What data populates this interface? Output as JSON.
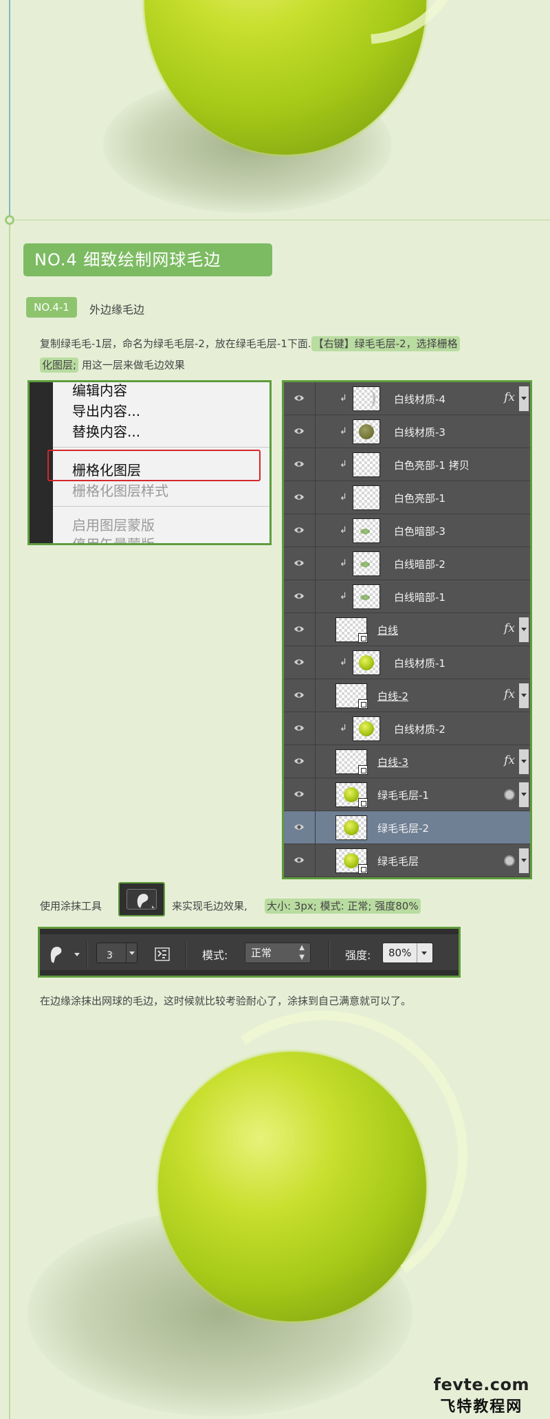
{
  "section": {
    "title": "NO.4  细致绘制网球毛边"
  },
  "subsection": {
    "badge": "NO.4-1",
    "title": "外边缘毛边"
  },
  "instruction1": {
    "line1_plain": "复制绿毛毛-1层，命名为绿毛毛层-2，放在绿毛毛层-1下面.",
    "line1_highlight": "【右键】绿毛毛层-2，选择栅格",
    "line2_highlight": "化图层;",
    "line2_plain": " 用这一层来做毛边效果"
  },
  "context_menu": {
    "items": [
      "编辑内容",
      "导出内容...",
      "替换内容...",
      "栅格化图层",
      "栅格化图层样式",
      "启用图层蒙版",
      "停用矢量蒙版"
    ],
    "selected": "栅格化图层"
  },
  "layers": [
    {
      "name": "白线材质-4",
      "kind": "clipped",
      "thumb": "seam",
      "fx": "fx"
    },
    {
      "name": "白线材质-3",
      "kind": "clipped",
      "thumb": "ball-dark"
    },
    {
      "name": "白色亮部-1 拷贝",
      "kind": "clipped",
      "thumb": "empty"
    },
    {
      "name": "白色亮部-1",
      "kind": "clipped",
      "thumb": "empty"
    },
    {
      "name": "白色暗部-3",
      "kind": "clipped",
      "thumb": "dot"
    },
    {
      "name": "白线暗部-2",
      "kind": "clipped",
      "thumb": "dot"
    },
    {
      "name": "白线暗部-1",
      "kind": "clipped",
      "thumb": "dot"
    },
    {
      "name": "白线",
      "kind": "smart",
      "thumb": "smart",
      "fx": "fx"
    },
    {
      "name": "白线材质-1",
      "kind": "clipped",
      "thumb": "ball"
    },
    {
      "name": "白线-2",
      "kind": "smart",
      "thumb": "smart",
      "fx": "fx"
    },
    {
      "name": "白线材质-2",
      "kind": "clipped",
      "thumb": "ball"
    },
    {
      "name": "白线-3",
      "kind": "smart",
      "thumb": "smart",
      "fx": "fx"
    },
    {
      "name": "绿毛毛层-1",
      "kind": "base",
      "thumb": "ball-smart",
      "filter": true
    },
    {
      "name": "绿毛毛层-2",
      "kind": "base",
      "thumb": "ball",
      "selected": true
    },
    {
      "name": "绿毛毛层",
      "kind": "base",
      "thumb": "ball-smart",
      "filter": true
    }
  ],
  "tool_line": {
    "prefix": "使用涂抹工具",
    "suffix": "来实现毛边效果,",
    "highlight": "大小: 3px;   模式: 正常;   强度80%"
  },
  "options_bar": {
    "brush_size": "3",
    "mode_label": "模式:",
    "mode_value": "正常",
    "strength_label": "强度:",
    "strength_value": "80%"
  },
  "instruction2": "在边缘涂抹出网球的毛边，这时候就比较考验耐心了，涂抹到自己满意就可以了。",
  "watermark": {
    "line1": "fevte.com",
    "line2": "飞特教程网"
  }
}
